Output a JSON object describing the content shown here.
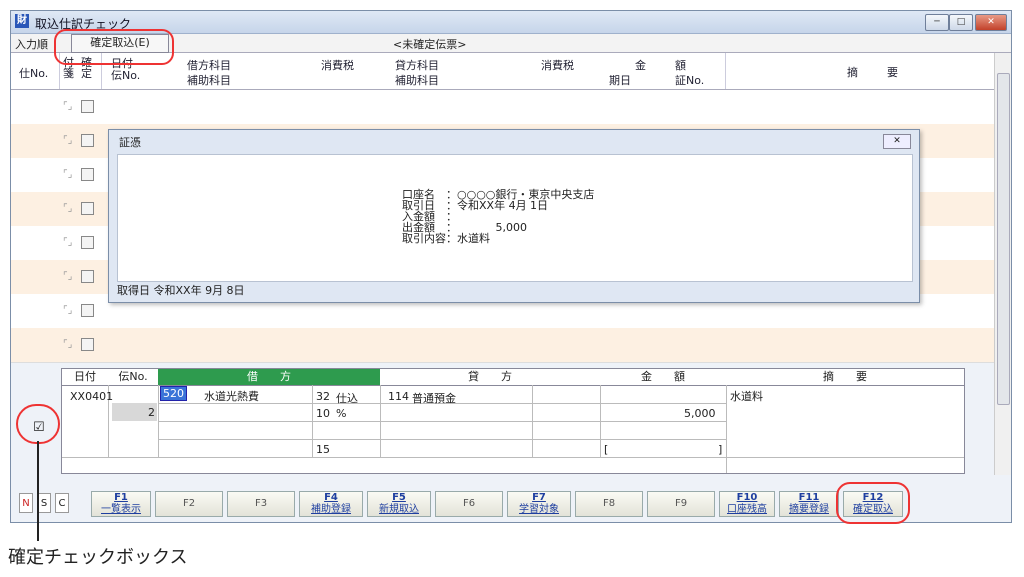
{
  "window": {
    "title": "取込仕訳チェック",
    "app_icon": "財",
    "btn_min": "─",
    "btn_max": "□",
    "btn_close": "✕"
  },
  "toolbar": {
    "order_label": "入力順",
    "kakutei_label": "確定取込(E)",
    "ticket_status": "<未確定伝票>"
  },
  "grid_header": {
    "shiwake_no": "仕No.",
    "fusen": "付箋",
    "kakutei": "確定",
    "date": "日付",
    "den_no": "伝No.",
    "debit_account": "借方科目",
    "debit_sub": "補助科目",
    "debit_tax": "消費税",
    "credit_account": "貸方科目",
    "credit_sub": "補助科目",
    "credit_tax": "消費税",
    "amount_kin": "金",
    "amount_gaku": "額",
    "period": "期日",
    "voucher_no": "証No.",
    "summary_teki": "摘",
    "summary_you": "要"
  },
  "popup": {
    "title": "証憑",
    "close": "✕",
    "lines": [
      "口座名　：○○○○銀行・東京中央支店",
      "取引日　：令和XX年 4月 1日",
      "入金額　：",
      "出金額　：　　　　5,000",
      "取引内容：水道料"
    ],
    "footer": "取得日 令和XX年 9月 8日"
  },
  "entry": {
    "h_date": "日付",
    "h_den": "伝No.",
    "h_debit": "借　　方",
    "h_credit": "貸　　方",
    "h_amount": "金　　額",
    "h_summary": "摘　　要",
    "date": "XX0401",
    "den_no": "2",
    "debit_code": "520",
    "debit_name": "水道光熱費",
    "tax_code": "32",
    "tax_name": "仕込",
    "tax_rate": "10",
    "tax_pct": "%",
    "tax_extra": "15",
    "credit_code": "114",
    "credit_name": "普通預金",
    "amount": "5,000",
    "bracket_open": "[",
    "bracket_close": "]",
    "summary": "水道料"
  },
  "kakutei_checkbox": "☑",
  "fkeys": {
    "mode_n": "N",
    "mode_s": "S",
    "mode_c": "C",
    "f1": "F1",
    "f1_label": "一覧表示",
    "f2": "F2",
    "f3": "F3",
    "f4": "F4",
    "f4_label": "補助登録",
    "f5": "F5",
    "f5_label": "新規取込",
    "f6": "F6",
    "f7": "F7",
    "f7_label": "学習対象",
    "f8": "F8",
    "f9": "F9",
    "f10": "F10",
    "f10_label": "口座残高",
    "f11": "F11",
    "f11_label": "摘要登録",
    "f12": "F12",
    "f12_label": "確定取込"
  },
  "caption": "確定チェックボックス",
  "colors": {
    "highlight": "#e33333",
    "accent_header": "#2e9b4e",
    "row_alt": "#fdf0e2"
  }
}
